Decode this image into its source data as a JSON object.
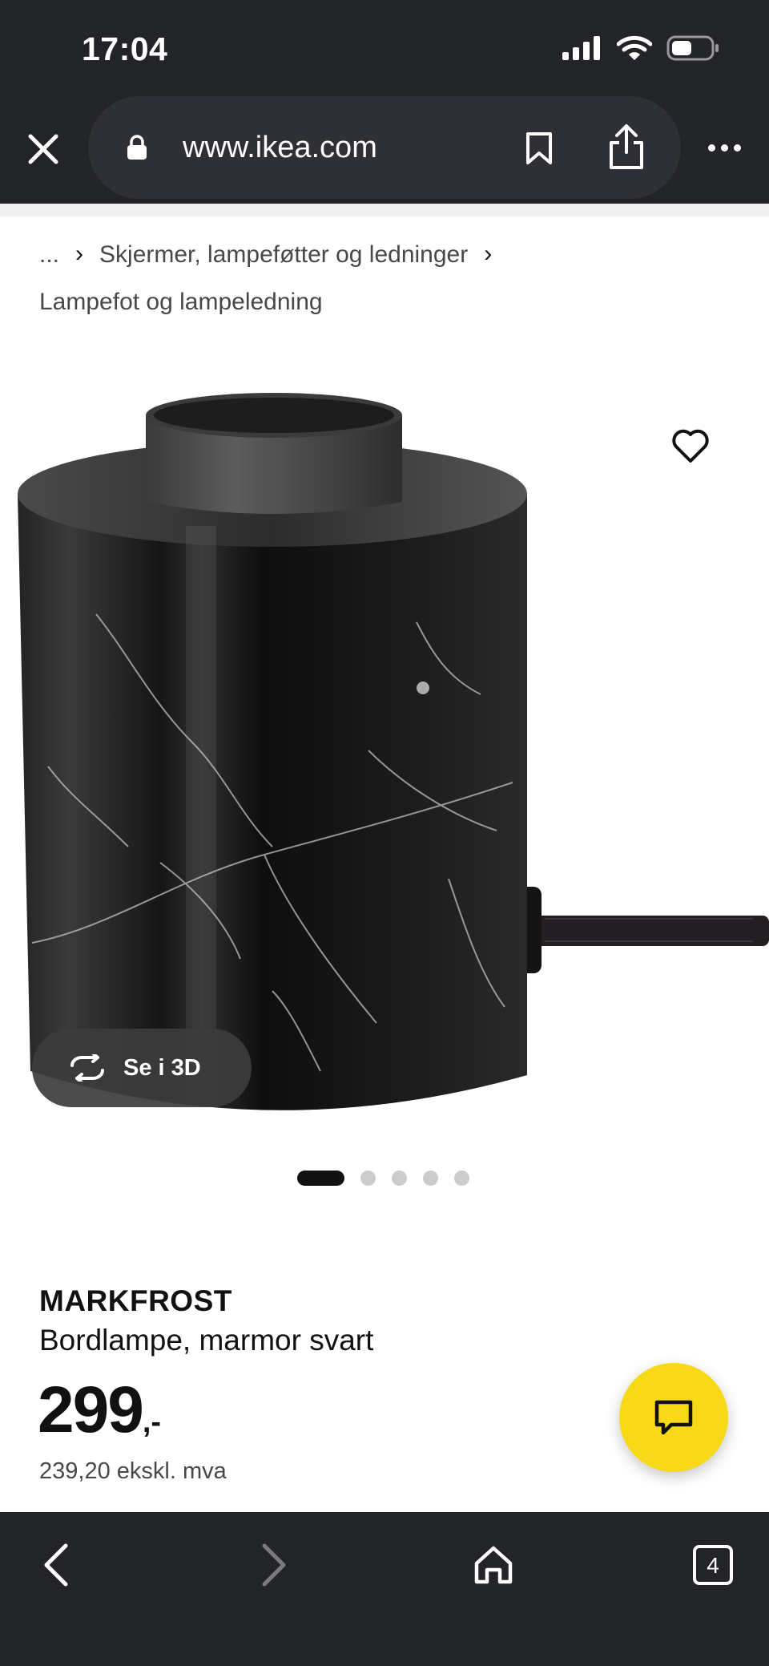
{
  "status_bar": {
    "time": "17:04"
  },
  "browser": {
    "url": "www.ikea.com",
    "tab_count": "4"
  },
  "breadcrumb": {
    "ellipsis": "...",
    "category": "Skjermer, lampeføtter og ledninger",
    "current": "Lampefot og lampeledning"
  },
  "gallery": {
    "view_3d_label": "Se i 3D",
    "image_count": 5,
    "active_index": 0
  },
  "product": {
    "name": "MARKFROST",
    "description": "Bordlampe, marmor svart",
    "price": "299",
    "price_suffix": ",-",
    "price_ex_vat": "239,20 ekskl. mva"
  },
  "colors": {
    "chrome_bg": "#232428",
    "accent_yellow": "#f7d917",
    "text": "#111111"
  }
}
